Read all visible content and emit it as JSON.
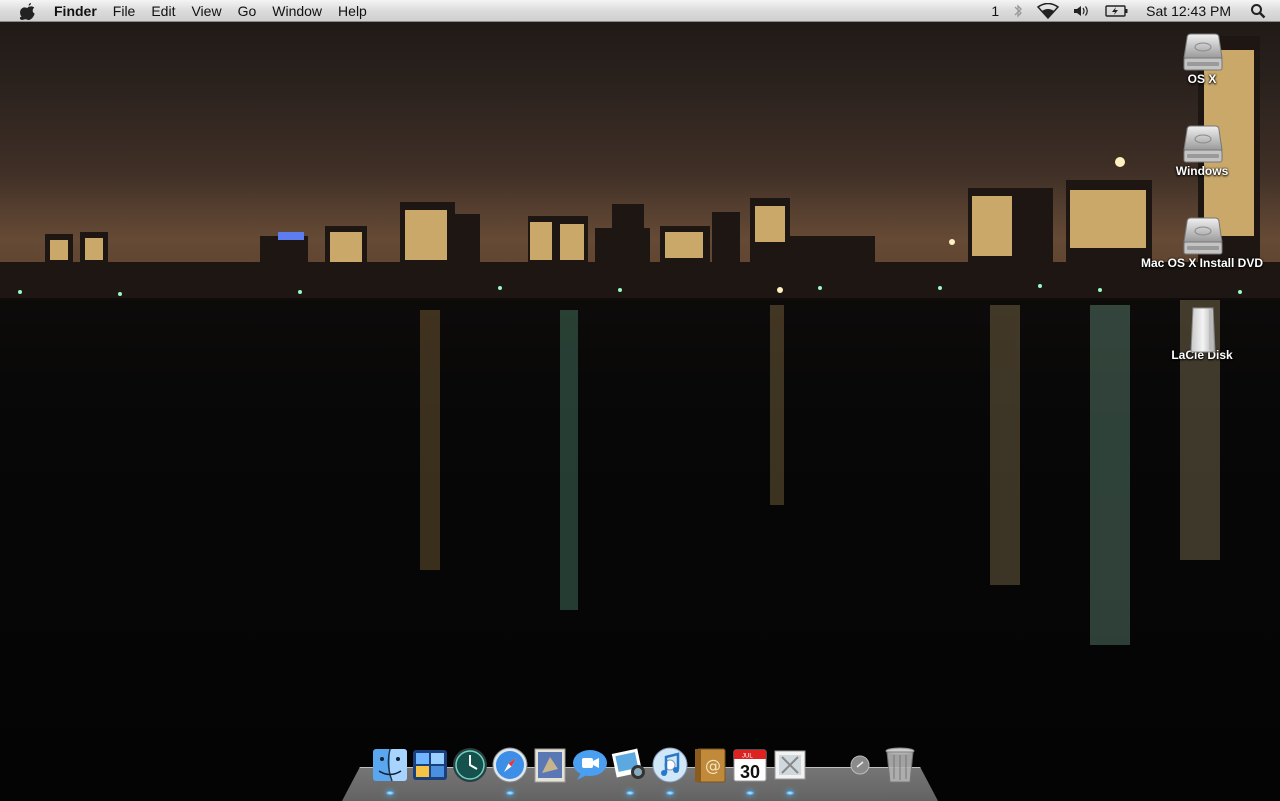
{
  "menubar": {
    "app_name": "Finder",
    "menus": [
      "File",
      "Edit",
      "View",
      "Go",
      "Window",
      "Help"
    ],
    "status": {
      "spaces_number": "1",
      "clock": "Sat 12:43 PM"
    }
  },
  "desktop": {
    "icons": [
      {
        "label": "OS X",
        "icon": "hard-drive-icon"
      },
      {
        "label": "Windows",
        "icon": "hard-drive-icon"
      },
      {
        "label": "Mac OS X Install DVD",
        "icon": "hard-drive-icon"
      },
      {
        "label": "LaCie Disk",
        "icon": "external-drive-icon"
      }
    ]
  },
  "dock": {
    "items": [
      {
        "name": "finder-icon",
        "running": true
      },
      {
        "name": "dashboard-icon",
        "running": false
      },
      {
        "name": "time-machine-icon",
        "running": false
      },
      {
        "name": "safari-icon",
        "running": true
      },
      {
        "name": "mail-icon",
        "running": false
      },
      {
        "name": "ichat-icon",
        "running": false
      },
      {
        "name": "iphoto-icon",
        "running": true
      },
      {
        "name": "itunes-icon",
        "running": true
      },
      {
        "name": "address-book-icon",
        "running": false
      },
      {
        "name": "ical-icon",
        "running": true
      },
      {
        "name": "preview-icon",
        "running": true
      }
    ],
    "ical_date": "30",
    "ical_month": "JUL"
  }
}
